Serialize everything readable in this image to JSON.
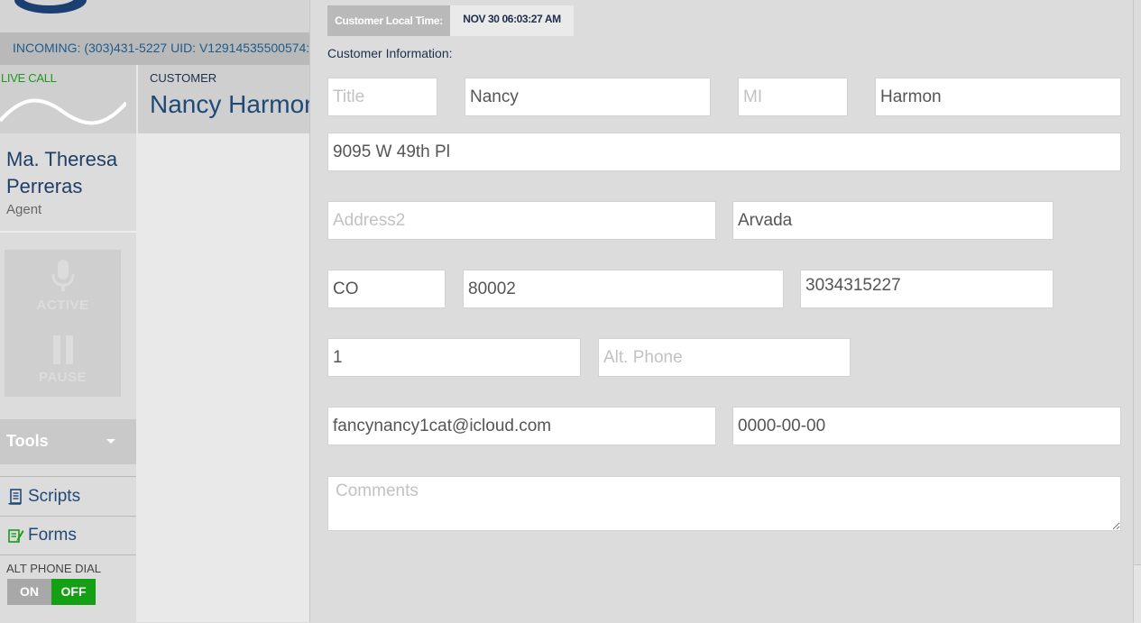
{
  "header": {
    "incoming": "INCOMING: (303)431-5227 UID: V12914535500574:"
  },
  "call": {
    "live_label": "LIVE CALL",
    "customer_label": "CUSTOMER",
    "customer_name": "Nancy Harmon"
  },
  "agent": {
    "name": "Ma. Theresa Perreras",
    "role": "Agent"
  },
  "controls": {
    "active_label": "ACTIVE",
    "pause_label": "PAUSE"
  },
  "sidebar": {
    "tools_label": "Tools",
    "items": [
      {
        "label": "Scripts",
        "icon": "scroll-icon"
      },
      {
        "label": "Forms",
        "icon": "edit-form-icon"
      }
    ],
    "alt_phone_dial": {
      "label": "ALT PHONE DIAL",
      "on_label": "ON",
      "off_label": "OFF",
      "state": "OFF"
    }
  },
  "customer_time": {
    "label": "Customer Local Time:",
    "value": "NOV 30 06:03:27 AM"
  },
  "form": {
    "section_label": "Customer Information:",
    "title": {
      "value": "",
      "placeholder": "Title"
    },
    "first_name": {
      "value": "Nancy",
      "placeholder": ""
    },
    "middle_initial": {
      "value": "",
      "placeholder": "MI"
    },
    "last_name": {
      "value": "Harmon",
      "placeholder": ""
    },
    "address1": {
      "value": "9095 W 49th Pl",
      "placeholder": ""
    },
    "address2": {
      "value": "",
      "placeholder": "Address2"
    },
    "city": {
      "value": "Arvada",
      "placeholder": ""
    },
    "state": {
      "value": "CO",
      "placeholder": ""
    },
    "postal_code": {
      "value": "80002",
      "placeholder": ""
    },
    "phone": {
      "value": "3034315227",
      "placeholder": ""
    },
    "phone_code": {
      "value": "1",
      "placeholder": ""
    },
    "alt_phone": {
      "value": "",
      "placeholder": "Alt. Phone"
    },
    "email": {
      "value": "fancynancy1cat@icloud.com",
      "placeholder": ""
    },
    "date_of_birth": {
      "value": "0000-00-00",
      "placeholder": ""
    },
    "comments": {
      "value": "",
      "placeholder": "Comments"
    }
  },
  "colors": {
    "live_green": "#1c9a1c",
    "brand_blue": "#1f4a78",
    "toggle_off_green": "#14a014"
  }
}
